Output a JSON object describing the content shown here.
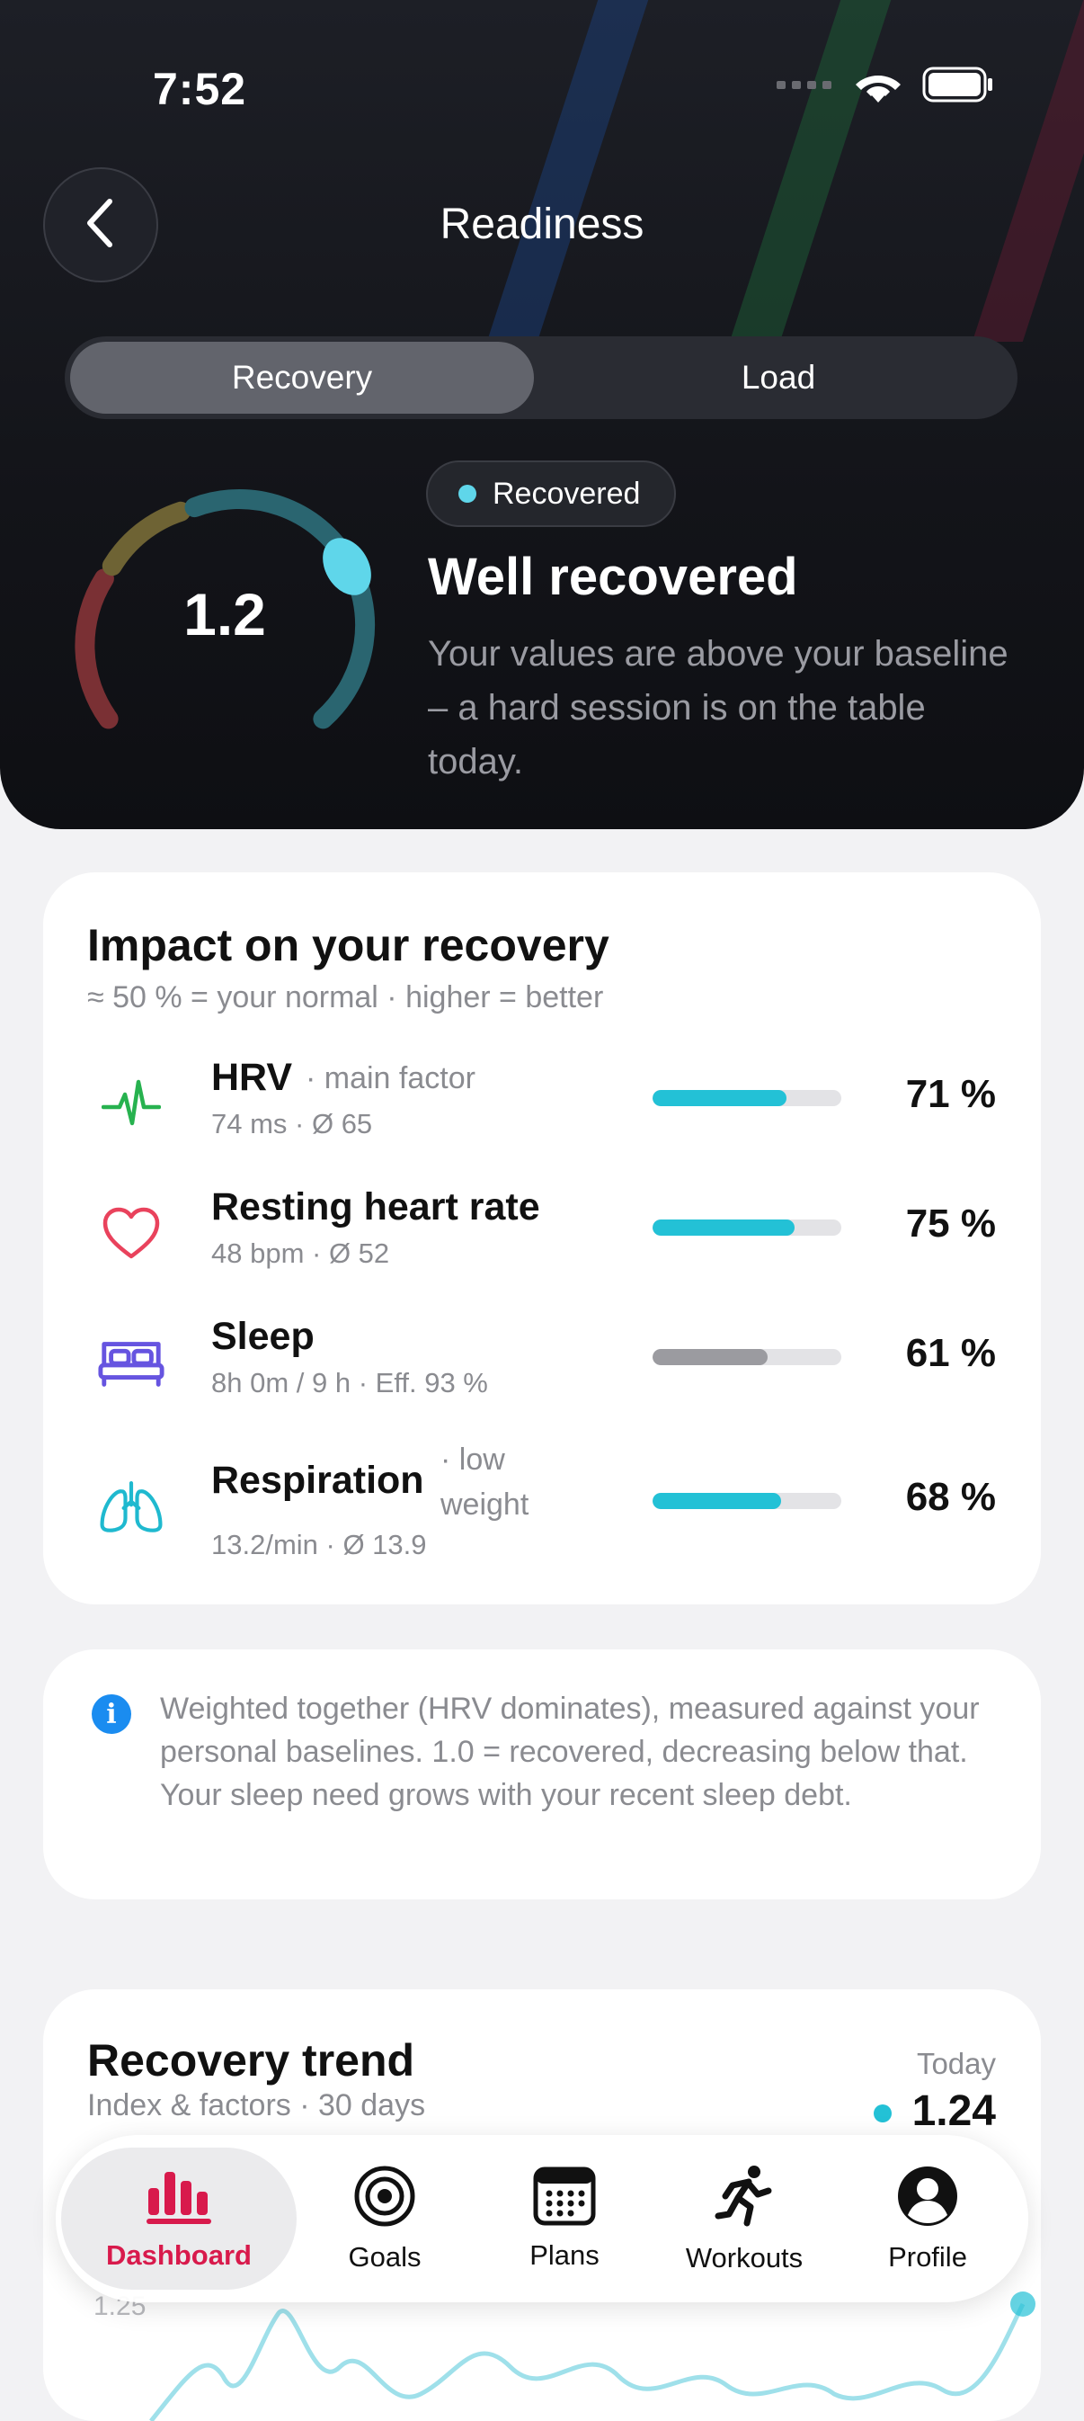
{
  "status_bar": {
    "time": "7:52"
  },
  "header": {
    "title": "Readiness"
  },
  "segments": {
    "recovery": "Recovery",
    "load": "Load"
  },
  "gauge": {
    "value": "1.2",
    "fill_fraction": 0.6
  },
  "status": {
    "badge": "Recovered",
    "heading": "Well recovered",
    "description": "Your values are above your baseline – a hard session is on the table today."
  },
  "impact": {
    "title": "Impact on your recovery",
    "subtitle": "≈ 50 % = your normal · higher = better",
    "factors": [
      {
        "name": "HRV",
        "tag": "· main factor",
        "detail": "74 ms · Ø 65",
        "percent": "71 %",
        "fraction": 0.71,
        "icon": "heartbeat-icon"
      },
      {
        "name": "Resting heart rate",
        "tag": "",
        "detail": "48 bpm · Ø 52",
        "percent": "75 %",
        "fraction": 0.75,
        "icon": "heart-icon"
      },
      {
        "name": "Sleep",
        "tag": "",
        "detail": "8h 0m / 9 h · Eff. 93 %",
        "percent": "61 %",
        "fraction": 0.61,
        "icon": "bed-icon"
      },
      {
        "name": "Respiration",
        "tag_line1": "· low",
        "tag_line2": "weight",
        "detail": "13.2/min · Ø 13.9",
        "percent": "68 %",
        "fraction": 0.68,
        "icon": "lungs-icon"
      }
    ]
  },
  "info": {
    "text": "Weighted together (HRV dominates), measured against your personal baselines. 1.0 = recovered, decreasing below that. Your sleep need grows with your recent sleep debt."
  },
  "trend": {
    "title": "Recovery trend",
    "subtitle": "Index & factors · 30 days",
    "today_label": "Today",
    "today_value": "1.24",
    "axis_label": "1.25"
  },
  "tabbar": {
    "items": [
      {
        "label": "Dashboard",
        "icon": "bar-chart-icon"
      },
      {
        "label": "Goals",
        "icon": "target-icon"
      },
      {
        "label": "Plans",
        "icon": "calendar-icon"
      },
      {
        "label": "Workouts",
        "icon": "runner-icon"
      },
      {
        "label": "Profile",
        "icon": "profile-icon"
      }
    ]
  },
  "colors": {
    "accent_cyan": "#23c1d6",
    "bar_gray": "#9b9ba0",
    "tab_active": "#d81a4c",
    "info_blue": "#1a8cf0"
  }
}
